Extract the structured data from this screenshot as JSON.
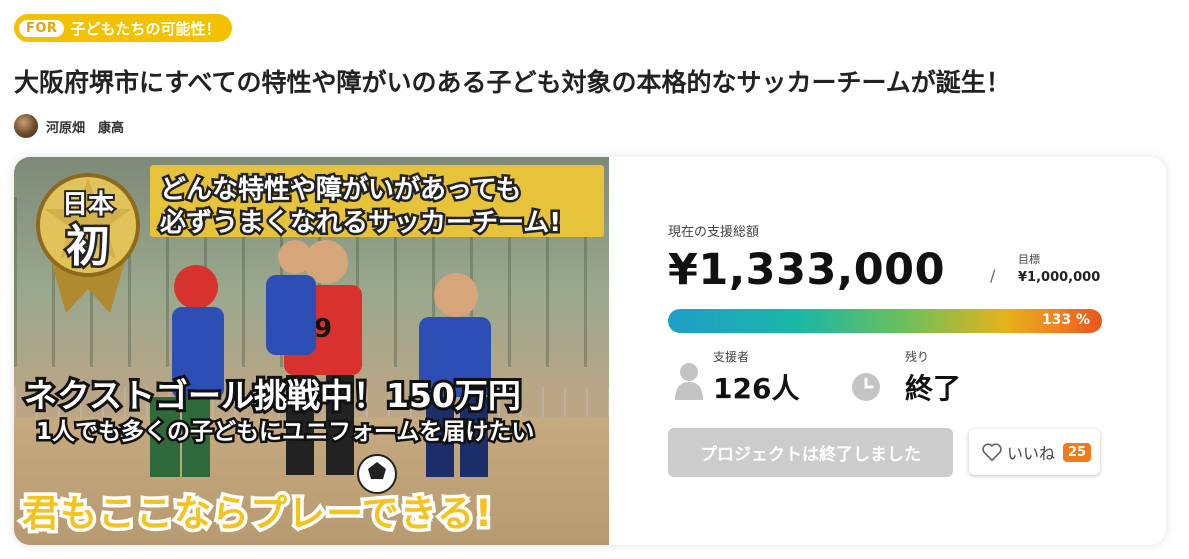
{
  "tag": {
    "for_label": "FOR",
    "text": "子どもたちの可能性！"
  },
  "title": "大阪府堺市にすべての特性や障がいのある子ども対象の本格的なサッカーチームが誕生！",
  "author": {
    "name": "河原畑　康高"
  },
  "hero": {
    "badge_line1": "日本",
    "badge_line2": "初",
    "banner_line1": "どんな特性や障がいがあっても",
    "banner_line2": "必ずうまくなれるサッカーチーム!",
    "sub1": "ネクストゴール挑戦中！150万円",
    "sub2": "1人でも多くの子どもにユニフォームを届けたい",
    "bottom": "君もここならプレーできる!",
    "bib_number": "9"
  },
  "funding": {
    "amount_label": "現在の支援総額",
    "amount": "¥1,333,000",
    "slash": "/",
    "goal_label": "目標",
    "goal_value": "¥1,000,000",
    "percent_text": "133 %",
    "percent": 133
  },
  "stats": {
    "backers_label": "支援者",
    "backers_value": "126人",
    "remaining_label": "残り",
    "remaining_value": "終了"
  },
  "actions": {
    "ended_label": "プロジェクトは終了しました",
    "like_label": "いいね",
    "like_count": "25"
  },
  "colors": {
    "tag_bg": "#f2c200",
    "accent_orange": "#f07a1e",
    "progress_start": "#1f9fc8",
    "progress_end": "#e8541e",
    "button_disabled": "#cccccc"
  },
  "icons": [
    "person-icon",
    "clock-icon",
    "heart-icon"
  ]
}
